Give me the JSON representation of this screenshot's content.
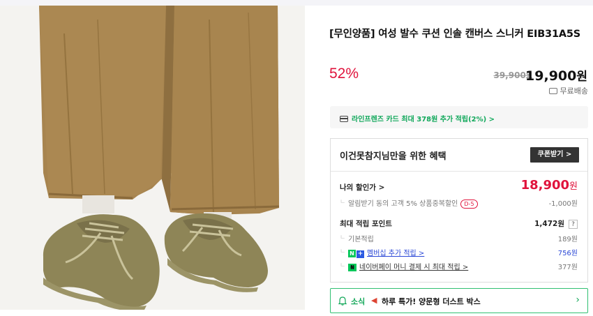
{
  "product": {
    "title": "[무인양품] 여성 발수 쿠션 인솔 캔버스 스니커 EIB31A5S",
    "discount_rate": "52%",
    "original_price": "39,900",
    "original_price_unit": "원",
    "sale_price": "19,900",
    "sale_price_unit": "원",
    "shipping": "무료배송",
    "image_alt": "product-photo"
  },
  "card_promo": {
    "text": "라인프렌즈 카드 최대 378원 추가 적립(2%) >"
  },
  "benefit": {
    "title": "이건못참지님만을 위한 혜택",
    "coupon_button": "쿠폰받기 >",
    "my_price_label": "나의 할인가 >",
    "my_price_value": "18,900",
    "my_price_unit": "원",
    "alarm_label": "알림받기 동의 고객 5% 상품중복할인",
    "alarm_badge": "D-5",
    "alarm_value": "-1,000원",
    "max_point_label": "최대 적립 포인트",
    "max_point_value": "1,472원",
    "help": "?",
    "base_label": "기본적립",
    "base_value": "189원",
    "membership_label": "멤버십 추가 적립 >",
    "membership_value": "756원",
    "naverpay_label": "네이버페이 머니 결제 시 최대 적립 >",
    "naverpay_value": "377원"
  },
  "news": {
    "label": "소식",
    "text": "하루 특가! 양문형 더스트 박스",
    "chevron": "›"
  },
  "colors": {
    "discount": "#e0133c",
    "green": "#14a85a",
    "link_blue": "#2b48d6"
  }
}
